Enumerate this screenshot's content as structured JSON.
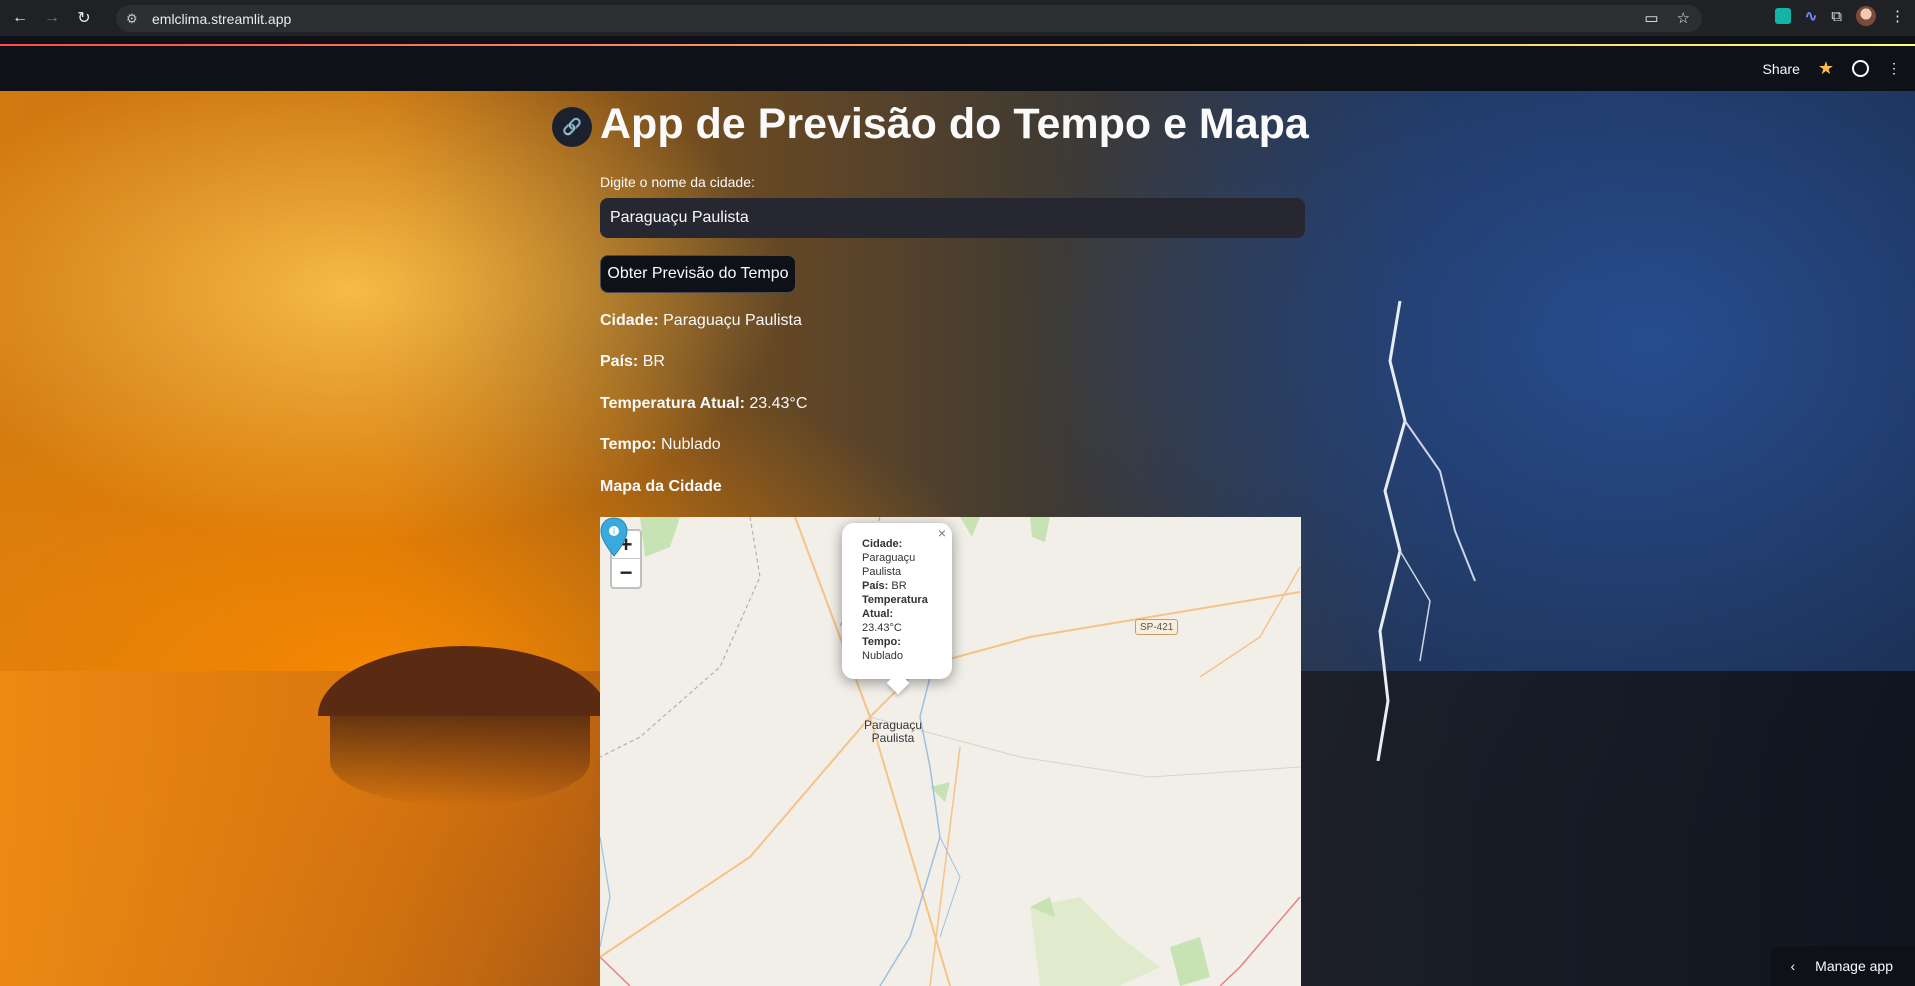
{
  "browser": {
    "url": "emlclima.streamlit.app"
  },
  "header": {
    "share_label": "Share"
  },
  "page": {
    "title": "App de Previsão do Tempo e Mapa",
    "input_label": "Digite o nome da cidade:",
    "input_value": "Paraguaçu Paulista",
    "button_label": "Obter Previsão do Tempo"
  },
  "results": {
    "city_label": "Cidade:",
    "city_value": "Paraguaçu Paulista",
    "country_label": "País:",
    "country_value": "BR",
    "temp_label": "Temperatura Atual:",
    "temp_value": "23.43°C",
    "weather_label": "Tempo:",
    "weather_value": "Nublado",
    "map_heading": "Mapa da Cidade"
  },
  "map": {
    "zoom_in": "+",
    "zoom_out": "−",
    "popup": {
      "city_label": "Cidade:",
      "city_value": "Paraguaçu Paulista",
      "country_label": "País:",
      "country_value": "BR",
      "temp_label": "Temperatura Atual:",
      "temp_value": "23.43°C",
      "weather_label": "Tempo:",
      "weather_value": "Nublado",
      "close": "×"
    },
    "place_label": "Paraguaçu Paulista",
    "road_shield": "SP-421"
  },
  "footer": {
    "manage_label": "Manage app"
  }
}
